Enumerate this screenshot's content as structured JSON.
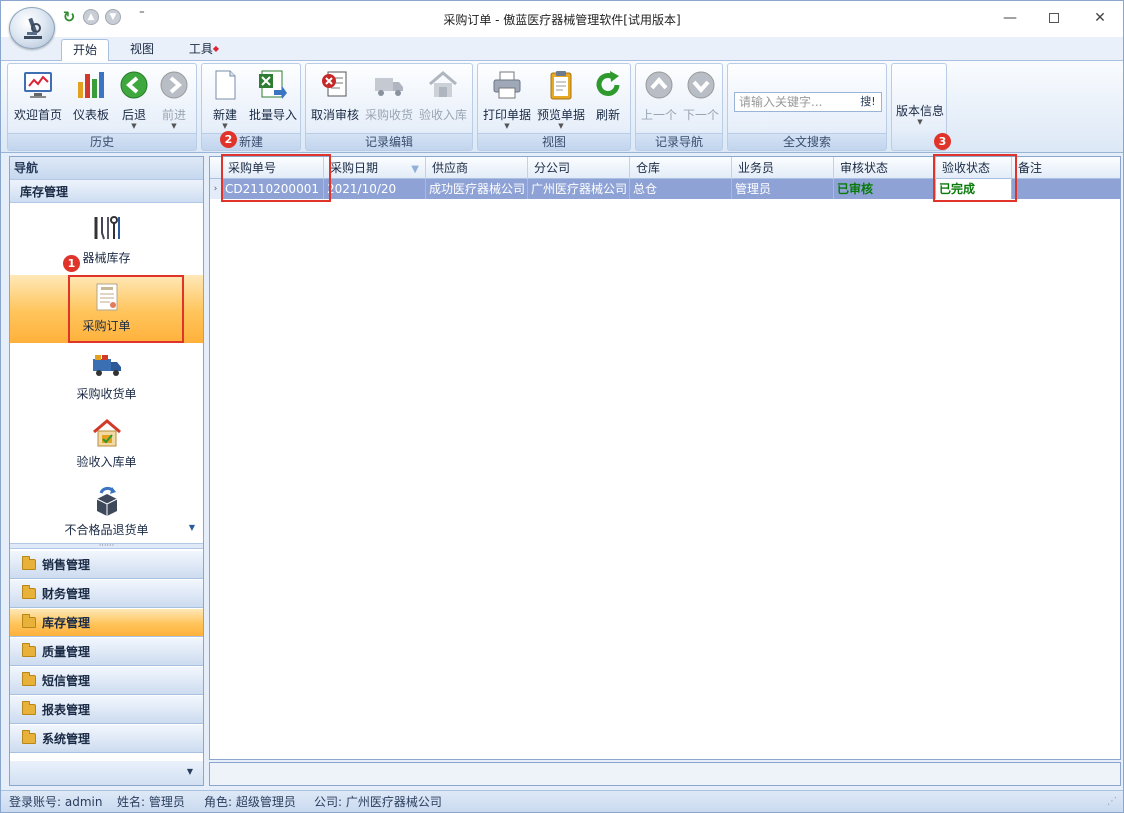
{
  "window": {
    "title": "采购订单 - 傲蓝医疗器械管理软件[试用版本]"
  },
  "tabs": [
    {
      "label": "开始"
    },
    {
      "label": "视图"
    },
    {
      "label": "工具"
    }
  ],
  "ribbon": {
    "history": {
      "label": "历史",
      "welcome": "欢迎首页",
      "dashboard": "仪表板",
      "back": "后退",
      "forward": "前进"
    },
    "new": {
      "label": "新建",
      "new_btn": "新建",
      "import_btn": "批量导入"
    },
    "edit": {
      "label": "记录编辑",
      "cancel_audit": "取消审核",
      "receive": "采购收货",
      "inspect": "验收入库"
    },
    "view": {
      "label": "视图",
      "print": "打印单据",
      "preview": "预览单据",
      "refresh": "刷新"
    },
    "record_nav": {
      "label": "记录导航",
      "prev": "上一个",
      "next": "下一个"
    },
    "search": {
      "label": "全文搜索",
      "placeholder": "请输入关键字...",
      "button": "搜!"
    },
    "version": {
      "label": "版本信息"
    }
  },
  "badges": [
    "1",
    "2",
    "3"
  ],
  "nav": {
    "header": "导航",
    "active_group": "库存管理",
    "items": [
      {
        "label": "器械库存",
        "icon": "instrument-tools-icon"
      },
      {
        "label": "采购订单",
        "icon": "purchase-order-icon"
      },
      {
        "label": "采购收货单",
        "icon": "delivery-truck-icon"
      },
      {
        "label": "验收入库单",
        "icon": "warehouse-icon"
      },
      {
        "label": "不合格品退货单",
        "icon": "return-box-icon"
      }
    ],
    "groups": [
      {
        "label": "销售管理"
      },
      {
        "label": "财务管理"
      },
      {
        "label": "库存管理"
      },
      {
        "label": "质量管理"
      },
      {
        "label": "短信管理"
      },
      {
        "label": "报表管理"
      },
      {
        "label": "系统管理"
      }
    ]
  },
  "grid": {
    "columns": [
      "采购单号",
      "采购日期",
      "供应商",
      "分公司",
      "仓库",
      "业务员",
      "审核状态",
      "验收状态",
      "备注"
    ],
    "rows": [
      {
        "order_no": "CD2110200001",
        "date": "2021/10/20",
        "supplier": "成功医疗器械公司",
        "branch": "广州医疗器械公司",
        "warehouse": "总仓",
        "salesman": "管理员",
        "audit_status": "已审核",
        "inspect_status": "已完成",
        "remark": ""
      }
    ]
  },
  "status": {
    "account": "登录账号: admin",
    "name": "姓名: 管理员",
    "role": "角色: 超级管理员",
    "company": "公司: 广州医疗器械公司"
  },
  "colors": {
    "accent": "#e0342a",
    "selected_row": "#8ea2d6",
    "selected_nav": "#ffc45a",
    "status_green": "#0a7a0a"
  }
}
